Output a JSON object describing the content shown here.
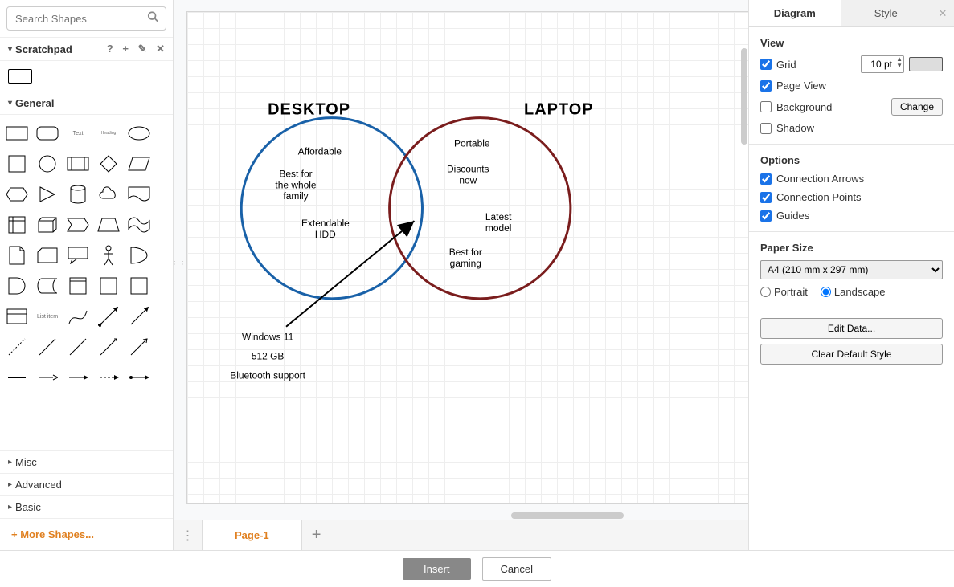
{
  "sidebar": {
    "search_placeholder": "Search Shapes",
    "sections": {
      "scratchpad": {
        "title": "Scratchpad"
      },
      "general": {
        "title": "General"
      }
    },
    "collapsed": {
      "misc": "Misc",
      "advanced": "Advanced",
      "basic": "Basic"
    },
    "more_shapes": "+  More Shapes...",
    "text_shape_label": "Text",
    "heading_shape_label": "Heading",
    "list_shape_label": "List item"
  },
  "canvas": {
    "tabs": {
      "page1": "Page-1"
    }
  },
  "diagram": {
    "title_left": "DESKTOP",
    "title_right": "LAPTOP",
    "left_items": {
      "a": "Affordable",
      "b1": "Best for",
      "b2": "the whole",
      "b3": "family",
      "c1": "Extendable",
      "c2": "HDD"
    },
    "right_items": {
      "a": "Portable",
      "b1": "Discounts",
      "b2": "now",
      "c1": "Latest",
      "c2": "model",
      "d1": "Best for",
      "d2": "gaming"
    },
    "outside": {
      "a": "Windows 11",
      "b": "512 GB",
      "c": "Bluetooth support"
    }
  },
  "right_panel": {
    "tabs": {
      "diagram": "Diagram",
      "style": "Style"
    },
    "view_heading": "View",
    "view": {
      "grid": "Grid",
      "grid_value": "10 pt",
      "page_view": "Page View",
      "background": "Background",
      "change_btn": "Change",
      "shadow": "Shadow"
    },
    "options_heading": "Options",
    "options": {
      "conn_arrows": "Connection Arrows",
      "conn_points": "Connection Points",
      "guides": "Guides"
    },
    "paper_heading": "Paper Size",
    "paper_value": "A4 (210 mm x 297 mm)",
    "portrait": "Portrait",
    "landscape": "Landscape",
    "edit_data": "Edit Data...",
    "clear_style": "Clear Default Style"
  },
  "footer": {
    "insert": "Insert",
    "cancel": "Cancel"
  }
}
